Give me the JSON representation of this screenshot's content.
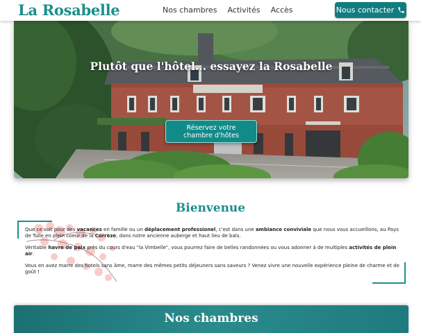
{
  "header": {
    "logo": "La Rosabelle",
    "nav": [
      "Nos chambres",
      "Activités",
      "Accès"
    ],
    "contact_label": "Nous contacter",
    "contact_icon": "phone-icon"
  },
  "hero": {
    "title": "Plutôt que l'hôtel... essayez la Rosabelle",
    "button_line1": "Réservez votre",
    "button_line2": "chambre d'hôtes"
  },
  "welcome": {
    "title": "Bienvenue",
    "p1": [
      {
        "t": "Que ce soit pour des ",
        "b": false
      },
      {
        "t": "vacances",
        "b": true
      },
      {
        "t": " en famille ou un ",
        "b": false
      },
      {
        "t": "déplacement professionel",
        "b": true
      },
      {
        "t": ", c'est dans une ",
        "b": false
      },
      {
        "t": "ambiance conviviale",
        "b": true
      },
      {
        "t": " que nous vous accueillons, au Pays de Tulle en plein coeur de la ",
        "b": false
      },
      {
        "t": "Corrèze",
        "b": true
      },
      {
        "t": ", dans notre ancienne auberge et haut lieu de bals.",
        "b": false
      }
    ],
    "p2": [
      {
        "t": "Véritable ",
        "b": false
      },
      {
        "t": "havre de paix",
        "b": true
      },
      {
        "t": " près du cours d'eau \"la Vimbelle\", vous pourrez faire de belles randonnées ou vous adonner à de multiples ",
        "b": false
      },
      {
        "t": "activités de plein air",
        "b": true
      },
      {
        "t": ".",
        "b": false
      }
    ],
    "p3": [
      {
        "t": "Vous en avez marre des hotels sans âme, marre des mêmes petits déjeuners sans saveurs ? Venez vivre une nouvelle expérience pleine de charme et de goût !",
        "b": false
      }
    ]
  },
  "rooms": {
    "title": "Nos chambres"
  },
  "colors": {
    "accent": "#1b8f8b",
    "button": "#127d80"
  }
}
